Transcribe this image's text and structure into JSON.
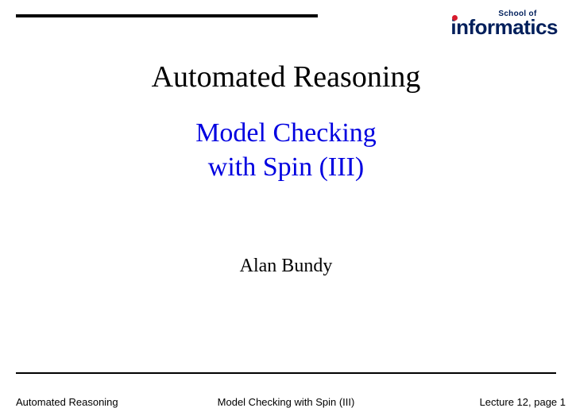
{
  "logo": {
    "top": "School of",
    "main": "nformatics"
  },
  "title": "Automated Reasoning",
  "subtitle_line1": "Model Checking",
  "subtitle_line2": "with Spin (III)",
  "author": "Alan Bundy",
  "footer": {
    "left": "Automated Reasoning",
    "center": "Model Checking with Spin (III)",
    "right": "Lecture 12, page 1"
  }
}
